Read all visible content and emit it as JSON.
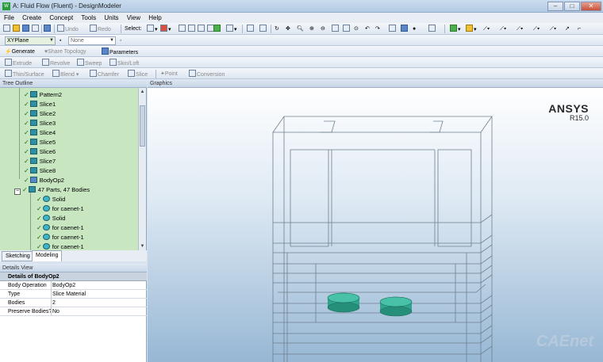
{
  "window": {
    "title": "A: Fluid Flow (Fluent) - DesignModeler",
    "minimize": "–",
    "maximize": "□",
    "close": "✕"
  },
  "menu": [
    "File",
    "Create",
    "Concept",
    "Tools",
    "Units",
    "View",
    "Help"
  ],
  "toolbar1": {
    "undo": "Undo",
    "redo": "Redo",
    "select_label": "Select:"
  },
  "toolbar2": {
    "plane": "XYPlane",
    "sketch": "None"
  },
  "toolbar3": {
    "generate": "Generate",
    "share_topology": "Share Topology",
    "parameters": "Parameters"
  },
  "toolbar4": {
    "extrude": "Extrude",
    "revolve": "Revolve",
    "sweep": "Sweep",
    "skin_loft": "Skin/Loft"
  },
  "toolbar5": {
    "thin_surface": "Thin/Surface",
    "blend": "Blend",
    "chamfer": "Chamfer",
    "slice": "Slice",
    "point": "Point",
    "conversion": "Conversion"
  },
  "tree_outline": {
    "header": "Tree Outline",
    "items": [
      "Pattern2",
      "Slice1",
      "Slice2",
      "Slice3",
      "Slice4",
      "Slice5",
      "Slice6",
      "Slice7",
      "Slice8",
      "BodyOp2",
      "47 Parts, 47 Bodies",
      "Solid",
      "for caenet-1",
      "Solid",
      "for caenet-1",
      "for caenet-1",
      "for caenet-1"
    ]
  },
  "tabs": [
    "Sketching",
    "Modeling"
  ],
  "details_view": {
    "header": "Details View",
    "title": "Details of BodyOp2",
    "rows": [
      {
        "key": "Body Operation",
        "value": "BodyOp2"
      },
      {
        "key": "Type",
        "value": "Slice Material"
      },
      {
        "key": "Bodies",
        "value": "2"
      },
      {
        "key": "Preserve Bodies?",
        "value": "No"
      }
    ]
  },
  "graphics": {
    "header": "Graphics",
    "brand": "ANSYS",
    "version": "R15.0",
    "watermark": "CAEnet"
  },
  "colors": {
    "tree_bg": "#c8e6c0",
    "cylinder": "#2fa58e",
    "edge": "#6f7f8f"
  }
}
